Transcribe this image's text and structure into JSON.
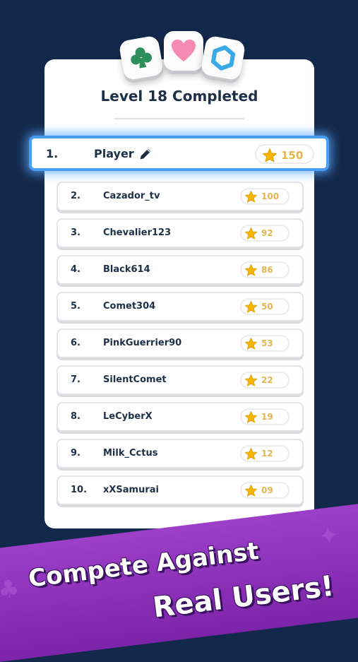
{
  "header": {
    "title": "Level 18 Completed",
    "tiles": [
      "club-icon",
      "heart-icon",
      "hexagon-icon"
    ]
  },
  "player": {
    "rank": "1.",
    "name": "Player",
    "score": "150"
  },
  "leaderboard": [
    {
      "rank": "2.",
      "name": "Cazador_tv",
      "score": "100"
    },
    {
      "rank": "3.",
      "name": "Chevalier123",
      "score": "92"
    },
    {
      "rank": "4.",
      "name": "Black614",
      "score": "86"
    },
    {
      "rank": "5.",
      "name": "Comet304",
      "score": "50"
    },
    {
      "rank": "6.",
      "name": "PinkGuerrier90",
      "score": "53"
    },
    {
      "rank": "7.",
      "name": "SilentComet",
      "score": "22"
    },
    {
      "rank": "8.",
      "name": "LeCyberX",
      "score": "19"
    },
    {
      "rank": "9.",
      "name": "Milk_Cctus",
      "score": "12"
    },
    {
      "rank": "10.",
      "name": "xXSamurai",
      "score": "09"
    }
  ],
  "banner": {
    "line1": "Compete Against",
    "line2": "Real Users!"
  },
  "colors": {
    "background": "#13294b",
    "highlight": "#4a9df6",
    "star": "#f4b400",
    "banner": "#8a2fb8"
  }
}
